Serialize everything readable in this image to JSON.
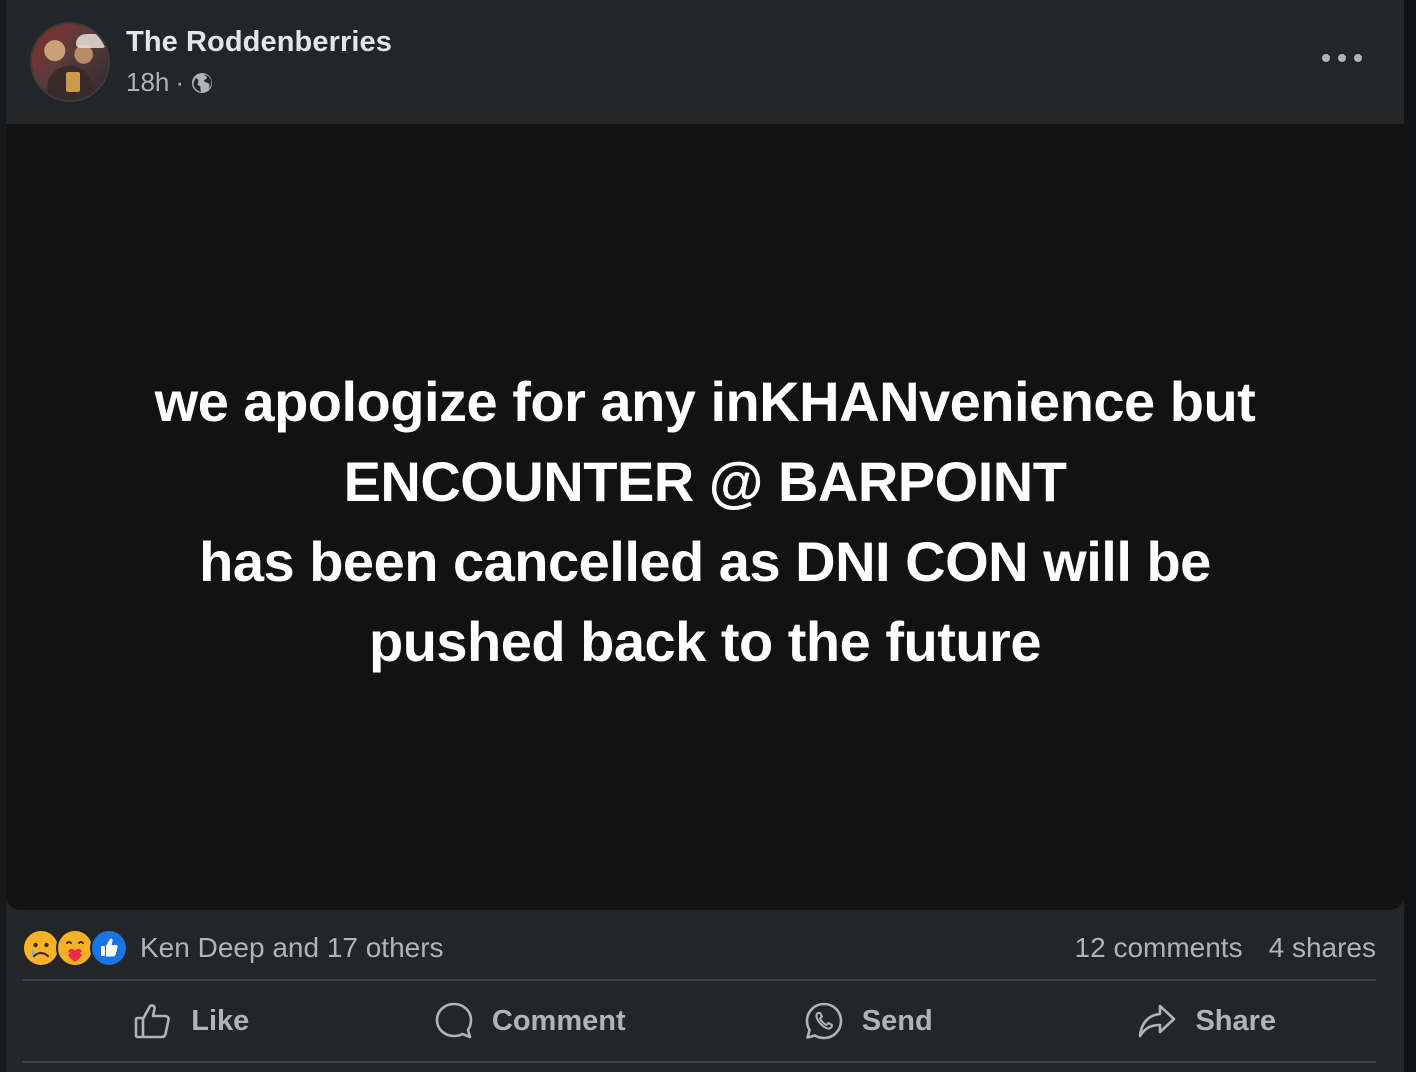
{
  "post": {
    "author": "The Roddenberries",
    "time": "18h",
    "separator": "·",
    "visibility_icon": "globe-icon",
    "more_icon": "more-options-icon"
  },
  "media": {
    "lines": [
      "we apologize for any inKHANvenience but",
      "ENCOUNTER @ BARPOINT",
      "has been cancelled as DNI CON will be",
      "pushed back to the future"
    ],
    "background": "#121212",
    "text_color": "#ffffff"
  },
  "stats": {
    "reaction_icons": [
      "sad-icon",
      "care-icon",
      "like-icon"
    ],
    "reactions_text": "Ken Deep and 17 others",
    "comments": "12 comments",
    "shares": "4 shares"
  },
  "actions": {
    "like": "Like",
    "comment": "Comment",
    "send": "Send",
    "share": "Share"
  },
  "colors": {
    "card": "#242526",
    "secondary_text": "#b0b3b8",
    "primary_text": "#e4e6eb",
    "like_blue": "#1b74e4",
    "reaction_yellow": "#f7b125"
  }
}
